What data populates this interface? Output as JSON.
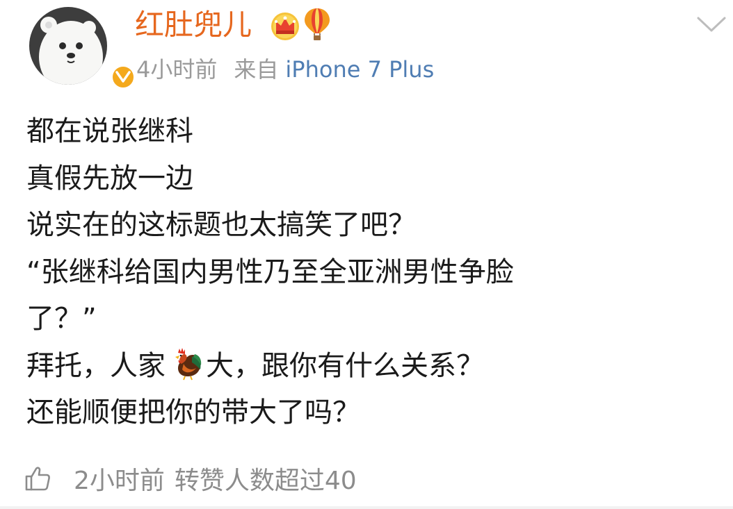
{
  "post": {
    "author": {
      "name": "红肚兜儿",
      "badge_icons": [
        "crown-icon",
        "balloon-icon"
      ],
      "avatar_icon": "polar-bear-avatar",
      "verified_icon": "verified-v-icon"
    },
    "meta": {
      "time": "4小时前",
      "source_prefix": "来自",
      "source_device": "iPhone 7 Plus"
    },
    "content_lines": [
      "都在说张继科",
      "真假先放一边",
      "说实在的这标题也太搞笑了吧？",
      "“张继科给国内男性乃至全亚洲男性争脸",
      "了？”",
      {
        "before": "拜托，人家",
        "emoji": "rooster-icon",
        "after": "大，跟你有什么关系？"
      },
      "还能顺便把你的带大了吗？"
    ],
    "footer": {
      "time": "2小时前",
      "likes_text": "转赞人数超过40"
    }
  },
  "colors": {
    "username": "#e6671e",
    "meta_gray": "#9a9a9a",
    "link_blue": "#4f7db3",
    "text": "#1a1a1a",
    "verified_badge": "#f4a91d"
  }
}
